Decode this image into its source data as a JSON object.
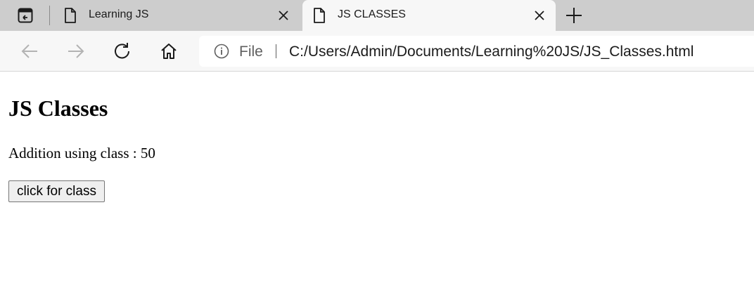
{
  "browser": {
    "tabs": [
      {
        "title": "Learning JS",
        "active": false
      },
      {
        "title": "JS CLASSES",
        "active": true
      }
    ],
    "address_bar": {
      "scheme_label": "File",
      "url": "C:/Users/Admin/Documents/Learning%20JS/JS_Classes.html"
    }
  },
  "page": {
    "heading": "JS Classes",
    "result_label": "Addition using class : ",
    "result_value": "50",
    "button_label": "click for class"
  },
  "icons": {
    "tab_actions": "tab-actions-icon",
    "page": "page-icon",
    "close": "close-icon",
    "new_tab": "plus-icon",
    "back": "back-arrow-icon",
    "forward": "forward-arrow-icon",
    "refresh": "refresh-icon",
    "home": "home-icon",
    "info": "info-icon"
  }
}
